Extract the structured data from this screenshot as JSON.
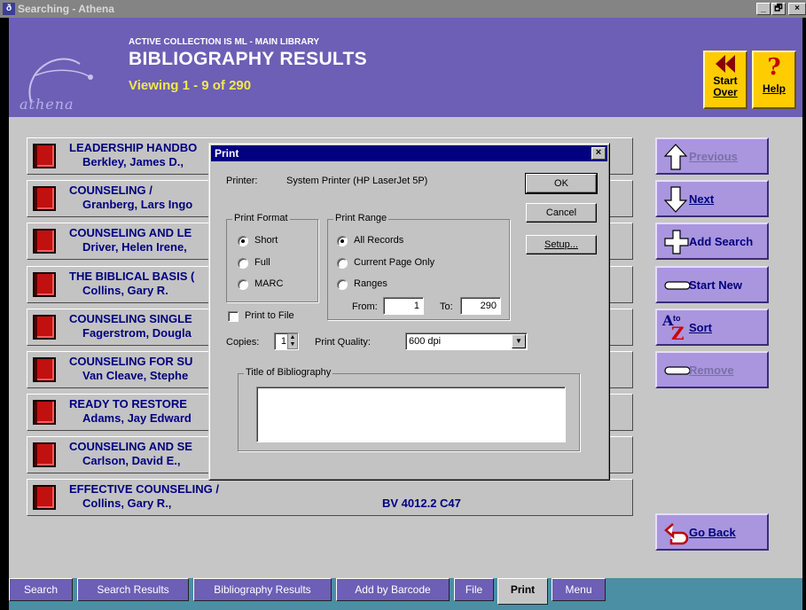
{
  "window": {
    "title": "Searching - Athena",
    "controls": [
      "_",
      "🗗",
      "×"
    ]
  },
  "header": {
    "collection": "ACTIVE COLLECTION IS ML - MAIN LIBRARY",
    "title": "BIBLIOGRAPHY RESULTS",
    "viewing": "Viewing 1 - 9 of 290",
    "logo_text": "athena",
    "start_over": {
      "line1": "Start",
      "line2": "Over"
    },
    "help": "Help"
  },
  "results": [
    {
      "title": "LEADERSHIP HANDBO",
      "author": "Berkley, James D.,",
      "call": ""
    },
    {
      "title": "COUNSELING /",
      "author": "Granberg, Lars Ingo",
      "call": ""
    },
    {
      "title": "COUNSELING AND LE",
      "author": "Driver, Helen Irene,",
      "call": ""
    },
    {
      "title": "THE BIBLICAL BASIS (",
      "author": "Collins, Gary R.",
      "call": ""
    },
    {
      "title": "COUNSELING SINGLE",
      "author": "Fagerstrom, Dougla",
      "call": ""
    },
    {
      "title": "COUNSELING FOR SU",
      "author": "Van Cleave, Stephe",
      "call": ""
    },
    {
      "title": "READY TO RESTORE",
      "author": "Adams, Jay Edward",
      "call": ""
    },
    {
      "title": "COUNSELING AND SE",
      "author": "Carlson, David E.,",
      "call": ""
    },
    {
      "title": "EFFECTIVE COUNSELING /",
      "author": "Collins, Gary R.,",
      "call": "BV 4012.2 C47"
    }
  ],
  "side_buttons": {
    "previous": "Previous",
    "next": "Next",
    "add_search": "Add Search",
    "start_new": "Start New",
    "sort": "Sort",
    "remove": "Remove",
    "go_back": "Go Back",
    "sort_icon_a": "A",
    "sort_icon_to": "to",
    "sort_icon_z": "Z"
  },
  "tabs": [
    "Search",
    "Search Results",
    "Bibliography Results",
    "Add by Barcode",
    "File",
    "Print",
    "Menu"
  ],
  "active_tab": "Print",
  "dialog": {
    "title": "Print",
    "printer_label": "Printer:",
    "printer_value": "System Printer (HP LaserJet 5P)",
    "ok": "OK",
    "cancel": "Cancel",
    "setup": "Setup...",
    "print_format": {
      "label": "Print Format",
      "options": [
        "Short",
        "Full",
        "MARC"
      ],
      "selected": "Short"
    },
    "print_range": {
      "label": "Print Range",
      "options": [
        "All Records",
        "Current Page Only",
        "Ranges"
      ],
      "selected": "All Records",
      "from_label": "From:",
      "from_value": "1",
      "to_label": "To:",
      "to_value": "290"
    },
    "print_to_file": {
      "label": "Print to File",
      "checked": false
    },
    "copies_label": "Copies:",
    "copies_value": "1",
    "quality_label": "Print Quality:",
    "quality_value": "600 dpi",
    "bib_title_label": "Title of Bibliography",
    "bib_title_value": ""
  },
  "colors": {
    "header": "#6c5fb5",
    "button_yellow": "#ffcc00",
    "dialog_title": "#000080",
    "row_text": "#000080",
    "tabbar": "#4a8fa3"
  }
}
